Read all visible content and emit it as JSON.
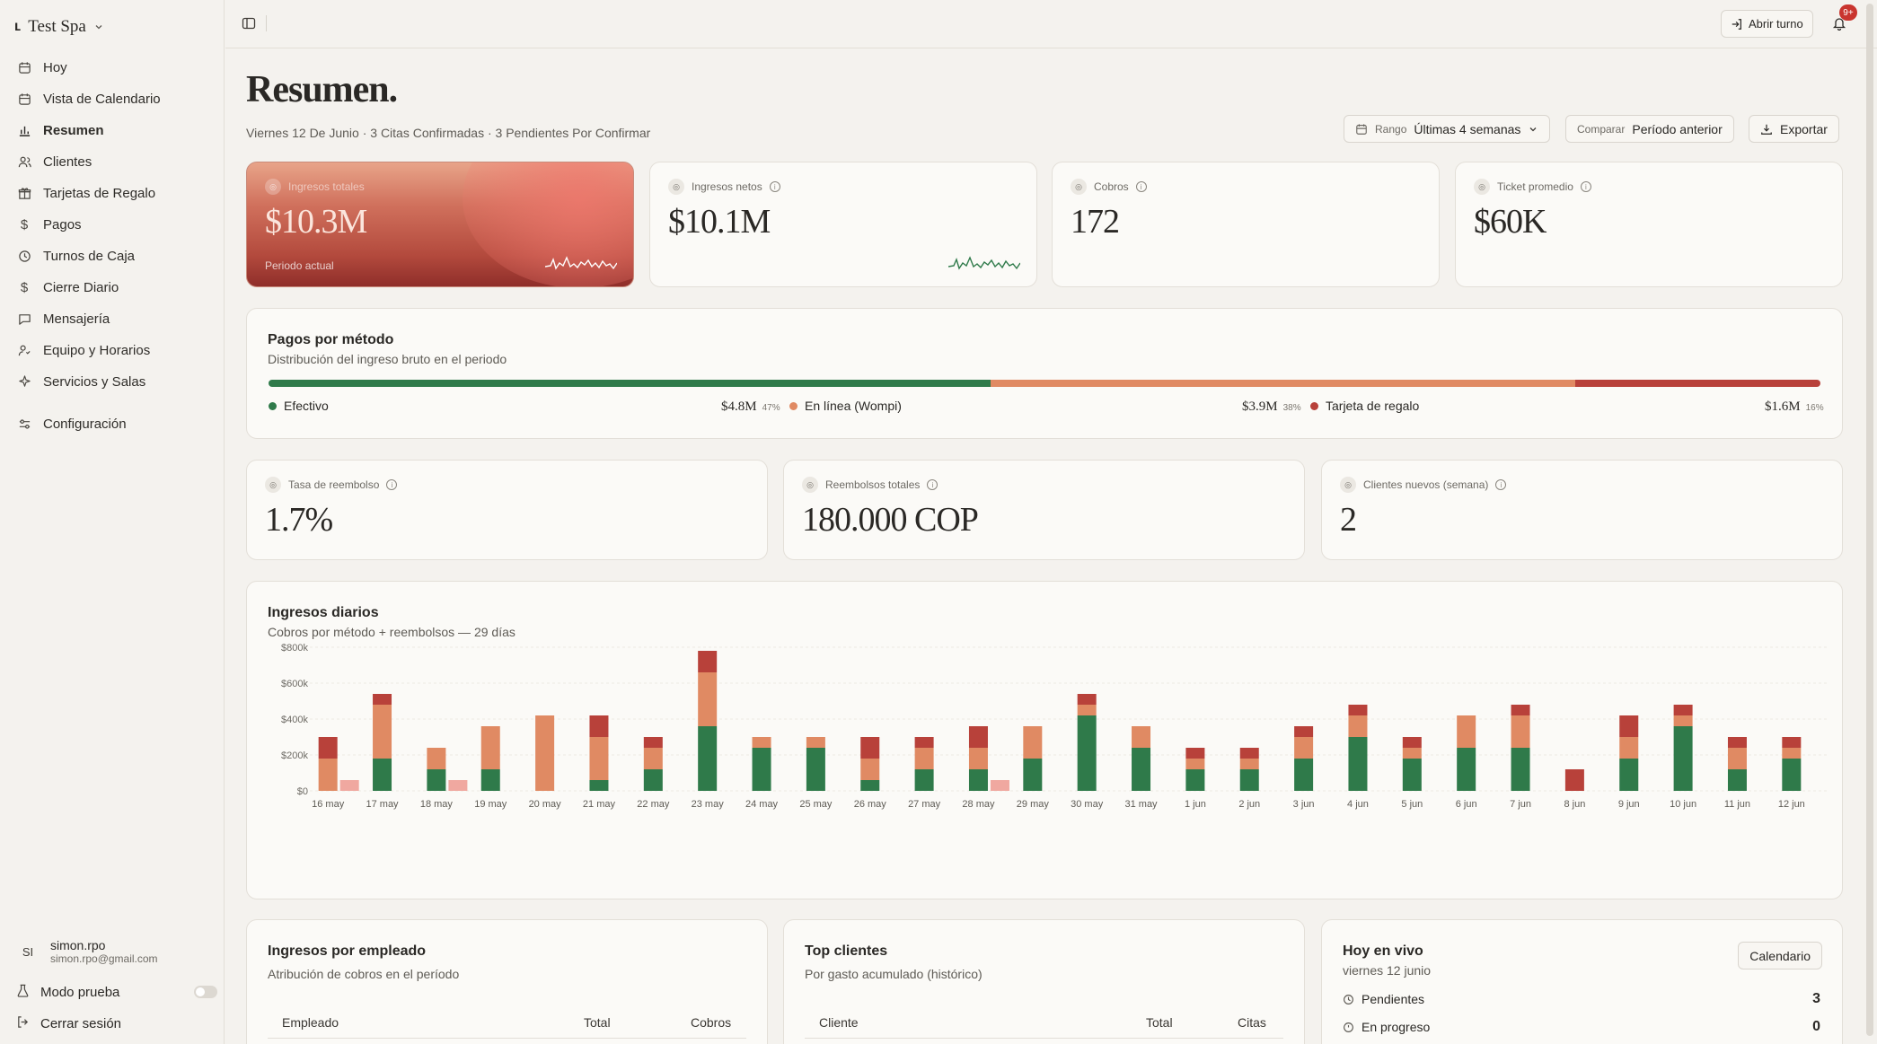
{
  "sidebar": {
    "brand": "Test Spa",
    "items": [
      {
        "label": "Hoy",
        "icon": "calendar-icon"
      },
      {
        "label": "Vista de Calendario",
        "icon": "calendar-icon"
      },
      {
        "label": "Resumen",
        "icon": "bar-chart-icon"
      },
      {
        "label": "Clientes",
        "icon": "users-icon"
      },
      {
        "label": "Tarjetas de Regalo",
        "icon": "gift-icon"
      },
      {
        "label": "Pagos",
        "icon": "dollar-icon"
      },
      {
        "label": "Turnos de Caja",
        "icon": "clock-icon"
      },
      {
        "label": "Cierre Diario",
        "icon": "dollar-icon"
      },
      {
        "label": "Mensajería",
        "icon": "message-icon"
      },
      {
        "label": "Equipo y Horarios",
        "icon": "team-icon"
      },
      {
        "label": "Servicios y Salas",
        "icon": "sparkle-icon"
      }
    ],
    "settings": "Configuración",
    "user": {
      "initials": "SI",
      "name": "simon.rpo",
      "email": "simon.rpo@gmail.com"
    },
    "test_mode": "Modo prueba",
    "logout": "Cerrar sesión"
  },
  "topbar": {
    "open_shift": "Abrir turno",
    "notifications_badge": "9+"
  },
  "header": {
    "title": "Resumen.",
    "subtitle": "Viernes 12 De Junio · 3 Citas Confirmadas · 3 Pendientes Por Confirmar",
    "range_label": "Rango",
    "range_value": "Últimas 4 semanas",
    "compare_label": "Comparar",
    "compare_value": "Período anterior",
    "export": "Exportar"
  },
  "kpis": [
    {
      "label": "Ingresos totales",
      "value": "$10.3M",
      "note": "Periodo actual"
    },
    {
      "label": "Ingresos netos",
      "value": "$10.1M"
    },
    {
      "label": "Cobros",
      "value": "172"
    },
    {
      "label": "Ticket promedio",
      "value": "$60K"
    }
  ],
  "payments": {
    "title": "Pagos por método",
    "subtitle": "Distribución del ingreso bruto en el periodo",
    "methods": [
      {
        "name": "Efectivo",
        "amount": "$4.8M",
        "pct": "47%",
        "share": 0.465,
        "color": "#2f7a4a"
      },
      {
        "name": "En línea (Wompi)",
        "amount": "$3.9M",
        "pct": "38%",
        "share": 0.377,
        "color": "#e08a63"
      },
      {
        "name": "Tarjeta de regalo",
        "amount": "$1.6M",
        "pct": "16%",
        "share": 0.158,
        "color": "#b8413a"
      }
    ]
  },
  "kpis2": [
    {
      "label": "Tasa de reembolso",
      "value": "1.7%"
    },
    {
      "label": "Reembolsos totales",
      "value": "180.000 COP"
    },
    {
      "label": "Clientes nuevos (semana)",
      "value": "2"
    }
  ],
  "daily": {
    "title": "Ingresos diarios",
    "subtitle": "Cobros por método + reembolsos — 29 días"
  },
  "chart_data": {
    "type": "bar",
    "stacked": true,
    "ylim": [
      0,
      800000
    ],
    "yticks": [
      "$0",
      "$200k",
      "$400k",
      "$600k",
      "$800k"
    ],
    "ytick_values": [
      0,
      200000,
      400000,
      600000,
      800000
    ],
    "categories": [
      "16 may",
      "17 may",
      "18 may",
      "19 may",
      "20 may",
      "21 may",
      "22 may",
      "23 may",
      "24 may",
      "25 may",
      "26 may",
      "27 may",
      "28 may",
      "29 may",
      "30 may",
      "31 may",
      "1 jun",
      "2 jun",
      "3 jun",
      "4 jun",
      "5 jun",
      "6 jun",
      "7 jun",
      "8 jun",
      "9 jun",
      "10 jun",
      "11 jun",
      "12 jun"
    ],
    "series": [
      {
        "color": "#2f7a4a",
        "values": [
          0,
          180000,
          120000,
          120000,
          0,
          60000,
          120000,
          360000,
          240000,
          240000,
          60000,
          120000,
          120000,
          180000,
          420000,
          240000,
          120000,
          120000,
          180000,
          300000,
          180000,
          240000,
          240000,
          0,
          180000,
          360000,
          120000,
          180000
        ]
      },
      {
        "color": "#e08a63",
        "values": [
          180000,
          300000,
          120000,
          240000,
          420000,
          240000,
          120000,
          300000,
          60000,
          60000,
          120000,
          120000,
          120000,
          180000,
          60000,
          120000,
          60000,
          60000,
          120000,
          120000,
          60000,
          180000,
          180000,
          0,
          120000,
          60000,
          120000,
          60000
        ]
      },
      {
        "color": "#b8413a",
        "values": [
          120000,
          60000,
          0,
          0,
          0,
          120000,
          60000,
          120000,
          0,
          0,
          120000,
          60000,
          120000,
          0,
          60000,
          0,
          60000,
          60000,
          60000,
          60000,
          60000,
          0,
          60000,
          120000,
          120000,
          60000,
          60000,
          60000
        ]
      },
      {
        "color": "#f0a8a0",
        "values": [
          60000,
          0,
          60000,
          0,
          0,
          0,
          0,
          0,
          0,
          0,
          0,
          0,
          60000,
          0,
          0,
          0,
          0,
          0,
          0,
          0,
          0,
          0,
          0,
          0,
          0,
          0,
          0,
          0
        ]
      }
    ]
  },
  "employees": {
    "title": "Ingresos por empleado",
    "subtitle": "Atribución de cobros en el período",
    "columns": [
      "Empleado",
      "Total",
      "Cobros"
    ]
  },
  "clients": {
    "title": "Top clientes",
    "subtitle": "Por gasto acumulado (histórico)",
    "columns": [
      "Cliente",
      "Total",
      "Citas"
    ]
  },
  "live": {
    "title": "Hoy en vivo",
    "date": "viernes 12 junio",
    "button": "Calendario",
    "rows": [
      {
        "label": "Pendientes",
        "count": "3"
      },
      {
        "label": "En progreso",
        "count": "0"
      }
    ]
  }
}
